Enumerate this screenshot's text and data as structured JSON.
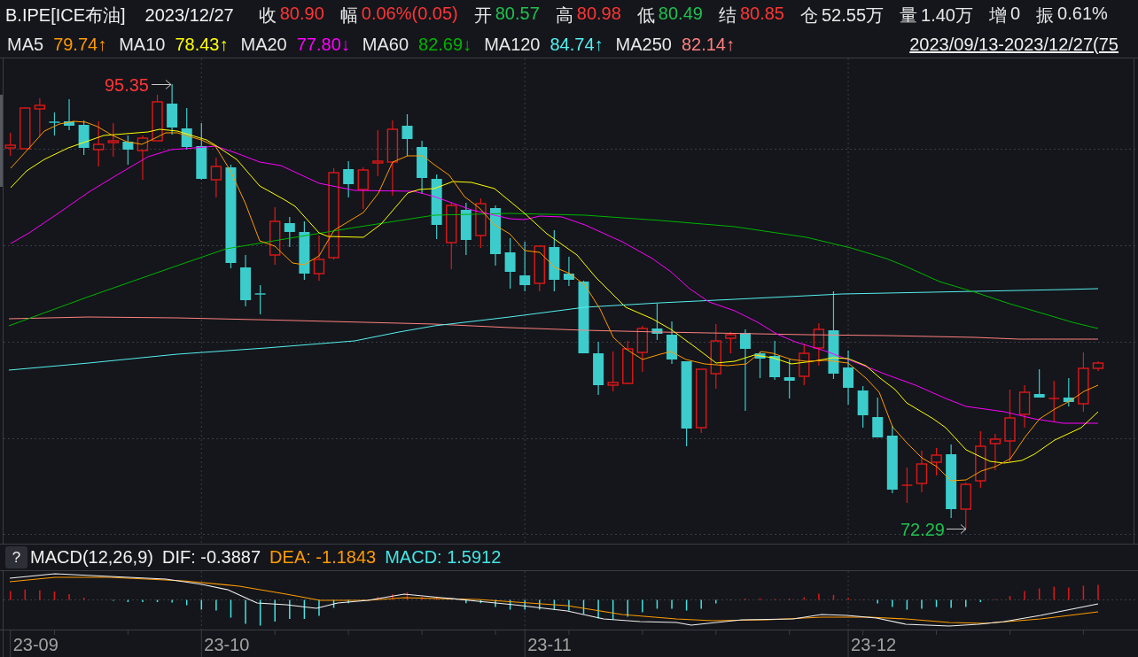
{
  "quote_bar": {
    "symbol": "B.IPE[ICE布油]",
    "date": "2023/12/27",
    "fields": [
      {
        "label": "收",
        "value": "80.90",
        "color": "#ff3535"
      },
      {
        "label": "幅",
        "value": "0.06%(0.05)",
        "color": "#ff3535"
      },
      {
        "label": "开",
        "value": "80.57",
        "color": "#20c050"
      },
      {
        "label": "高",
        "value": "80.98",
        "color": "#ff3535"
      },
      {
        "label": "低",
        "value": "80.49",
        "color": "#20c050"
      },
      {
        "label": "结",
        "value": "80.85",
        "color": "#ff3535"
      },
      {
        "label": "仓",
        "value": "52.55万",
        "color": "#e8e8e8"
      },
      {
        "label": "量",
        "value": "1.40万",
        "color": "#e8e8e8"
      },
      {
        "label": "增",
        "value": "0",
        "color": "#e8e8e8"
      },
      {
        "label": "振",
        "value": "0.61%",
        "color": "#e8e8e8"
      }
    ]
  },
  "ma_legend": {
    "items": [
      {
        "label": "MA5",
        "value": "79.74↑",
        "color": "#ff9a00"
      },
      {
        "label": "MA10",
        "value": "78.43↑",
        "color": "#ffff00"
      },
      {
        "label": "MA20",
        "value": "77.80↓",
        "color": "#ff00ff"
      },
      {
        "label": "MA60",
        "value": "82.69↓",
        "color": "#00b400"
      },
      {
        "label": "MA120",
        "value": "84.74↑",
        "color": "#55f0f0"
      },
      {
        "label": "MA250",
        "value": "82.14↑",
        "color": "#ff8080"
      }
    ],
    "date_range": "2023/09/13-2023/12/27(75"
  },
  "price_chart": {
    "high_label": "95.35",
    "low_label": "72.29"
  },
  "macd_panel": {
    "help": "?",
    "items": [
      {
        "label": "MACD(12,26,9)",
        "color": "#f0f0f0"
      },
      {
        "label": "DIF: -0.3887",
        "color": "#f0f0f0"
      },
      {
        "label": "DEA: -1.1843",
        "color": "#ff9a00"
      },
      {
        "label": "MACD: 1.5912",
        "color": "#44e4e4"
      }
    ]
  },
  "x_axis": {
    "labels": [
      "23-09",
      "23-10",
      "23-11",
      "23-12"
    ]
  }
}
